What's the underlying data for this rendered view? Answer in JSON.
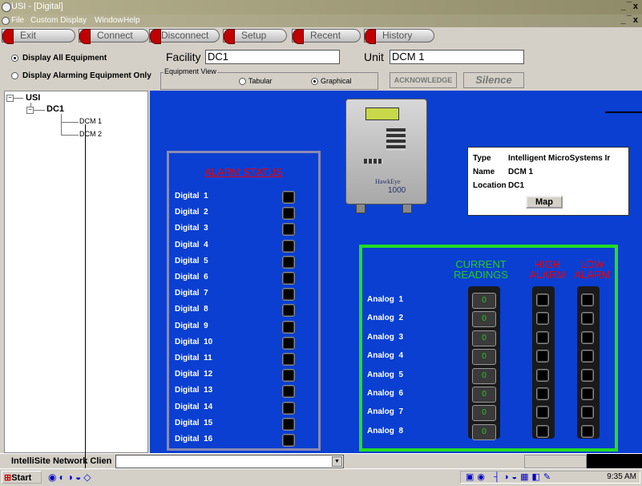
{
  "window": {
    "title": "USI - [Digital]",
    "controls": "_ ̅ x"
  },
  "menu": [
    "File",
    "Custom Display",
    "Window",
    "Help"
  ],
  "toolbar": [
    "Exit",
    "Connect",
    "Disconnect",
    "Setup",
    "Recent",
    "History"
  ],
  "options": {
    "display_all": "Display All Equipment",
    "display_alarming": "Display Alarming Equipment Only",
    "selected": "display_all"
  },
  "facility": {
    "label": "Facility",
    "value": "DC1"
  },
  "unit": {
    "label": "Unit",
    "value": "DCM 1"
  },
  "equipment_view": {
    "label": "Equipment View",
    "tabular": "Tabular",
    "graphical": "Graphical",
    "selected": "graphical"
  },
  "buttons": {
    "acknowledge": "ACKNOWLEDGE",
    "silence": "Silence",
    "map": "Map"
  },
  "tree": {
    "root": "USI",
    "site": "DC1",
    "units": [
      "DCM 1",
      "DCM 2"
    ]
  },
  "device": {
    "brand": "HawkEye",
    "model": "1000"
  },
  "info": {
    "type_label": "Type",
    "type_value": "Intelligent MicroSystems Ir",
    "name_label": "Name",
    "name_value": "DCM 1",
    "location_label": "Location",
    "location_value": "DC1"
  },
  "alarm_status": {
    "title": "ALARM STATUS",
    "items": [
      "Digital  1",
      "Digital  2",
      "Digital  3",
      "Digital  4",
      "Digital  5",
      "Digital  6",
      "Digital  7",
      "Digital  8",
      "Digital  9",
      "Digital  10",
      "Digital  11",
      "Digital  12",
      "Digital  13",
      "Digital  14",
      "Digital  15",
      "Digital  16"
    ]
  },
  "analog": {
    "headers": {
      "current": [
        "CURRENT",
        "READINGS"
      ],
      "high": [
        "HIGH",
        "ALARM"
      ],
      "low": [
        "LOW",
        "ALARM"
      ]
    },
    "items": [
      {
        "label": "Analog  1",
        "value": "0"
      },
      {
        "label": "Analog  2",
        "value": "0"
      },
      {
        "label": "Analog  3",
        "value": "0"
      },
      {
        "label": "Analog  4",
        "value": "0"
      },
      {
        "label": "Analog  5",
        "value": "0"
      },
      {
        "label": "Analog  6",
        "value": "0"
      },
      {
        "label": "Analog  7",
        "value": "0"
      },
      {
        "label": "Analog  8",
        "value": "0"
      }
    ]
  },
  "status_bar": {
    "text": "IntelliSite Network Clien"
  },
  "taskbar": {
    "start": "Start",
    "clock": "9:35 AM"
  },
  "colors": {
    "panel_blue": "#0a3fd1",
    "alarm_red": "#e00000",
    "current_green": "#22cc22",
    "analog_border": "#22dd22"
  }
}
